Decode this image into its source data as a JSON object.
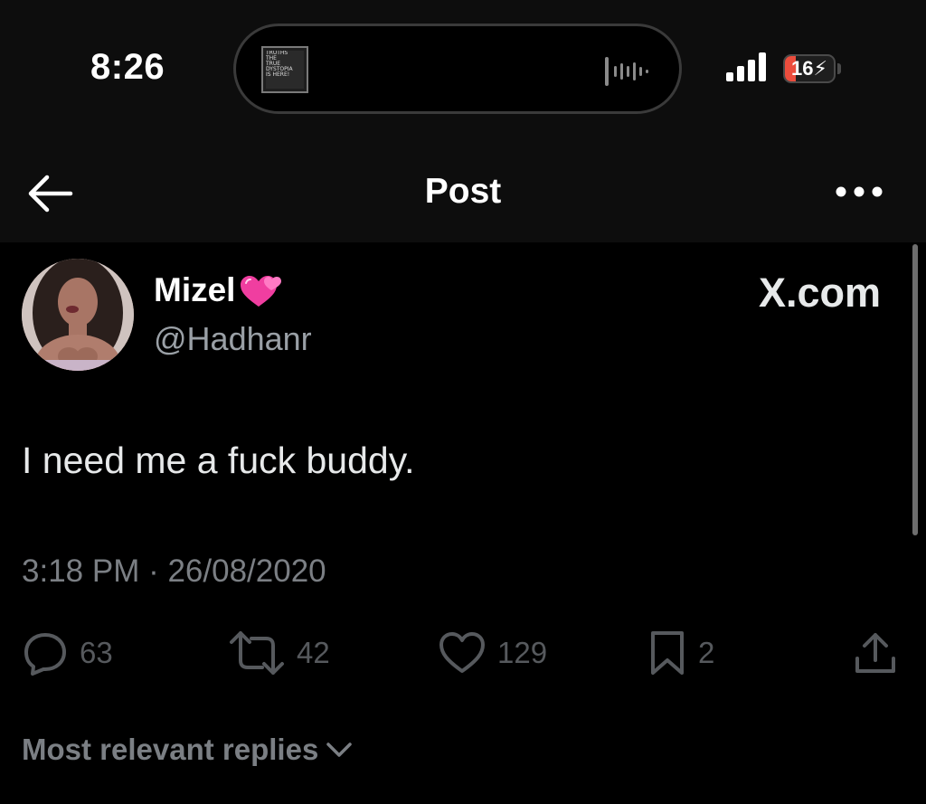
{
  "status_bar": {
    "time": "8:26",
    "battery": "16",
    "now_playing_art_lines": [
      "TRUTHS",
      "THE",
      "TRUE",
      "DYSTOPIA",
      "IS HERE!"
    ]
  },
  "header": {
    "title": "Post",
    "back_icon": "arrow-left-icon",
    "more_icon": "more-dots-icon"
  },
  "post": {
    "display_name": "Mizel",
    "name_emoji": "two-hearts-icon",
    "handle": "@Hadhanr",
    "watermark": "X.com",
    "text": "I need me a fuck buddy.",
    "timestamp": "3:18 PM · 26/08/2020"
  },
  "actions": {
    "replies": "63",
    "reposts": "42",
    "likes": "129",
    "bookmarks": "2"
  },
  "replies_sort": {
    "label": "Most relevant replies"
  },
  "colors": {
    "background": "#000000",
    "header_background": "#0d0d0d",
    "text_primary": "#e7e9ea",
    "text_secondary": "#7b7f84",
    "battery_low": "#eb4d3d",
    "heart_pink": "#f03ea0"
  }
}
